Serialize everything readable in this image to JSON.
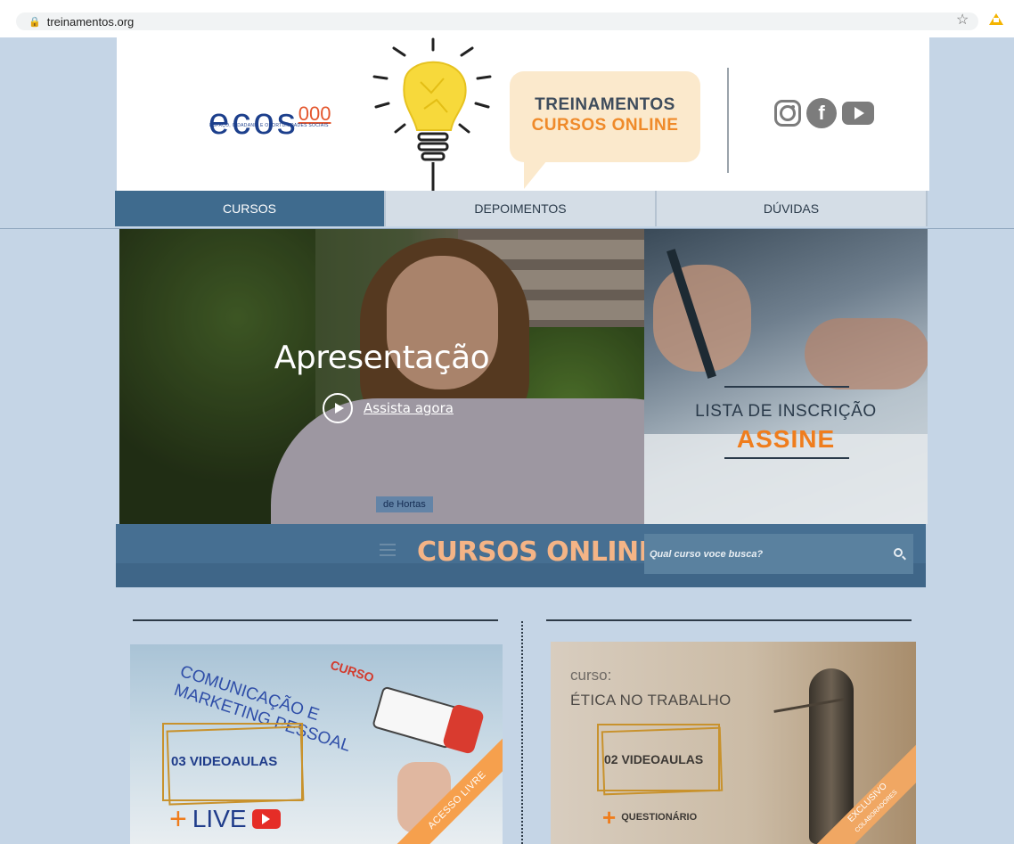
{
  "browser": {
    "url": "treinamentos.org"
  },
  "header": {
    "logo_name": "ecos",
    "logo_suffix": "000",
    "logo_tagline": "ESPAÇO, CIDADANIA E OPORTUNIDADES SOCIAIS",
    "bubble_line1": "TREINAMENTOS",
    "bubble_line2": "CURSOS ONLINE",
    "social": [
      "instagram-icon",
      "facebook-icon",
      "youtube-icon"
    ]
  },
  "nav": {
    "items": [
      "CURSOS",
      "DEPOIMENTOS",
      "DÚVIDAS"
    ],
    "active_index": 0
  },
  "hero": {
    "title": "Apresentação",
    "cta": "Assista agora",
    "shirt_text": "de Hortas",
    "subscribe_label": "LISTA DE INSCRIÇÃO",
    "subscribe_cta": "ASSINE"
  },
  "courses_bar": {
    "title": "CURSOS ONLINE",
    "search_placeholder": "Qual curso voce busca?"
  },
  "courses": [
    {
      "title": "COMUNICAÇÃO E MARKETING PESSOAL",
      "tag": "CURSO",
      "videos": "03  VIDEOAULAS",
      "extra": "LIVE",
      "ribbon": "ACESSO LIVRE"
    },
    {
      "tag": "curso:",
      "title": "ÉTICA NO TRABALHO",
      "videos": "02 VIDEOAULAS",
      "extra": "QUESTIONÁRIO",
      "ribbon": "EXCLUSIVO",
      "ribbon_sub": "COLABORADORES"
    }
  ],
  "colors": {
    "accent": "#ef7d1d",
    "nav_active": "#3f6b8e",
    "bar": "#466f92",
    "page_bg": "#c5d5e6"
  }
}
